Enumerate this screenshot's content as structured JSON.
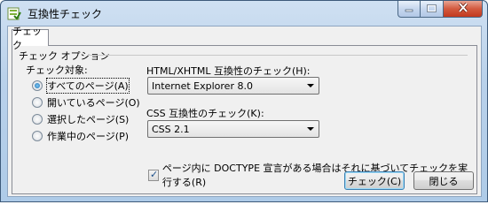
{
  "window": {
    "title": "互換性チェック"
  },
  "tab": {
    "label": "チェック"
  },
  "options": {
    "legend": "チェック オプション",
    "target_label": "チェック対象:",
    "radios": [
      {
        "label": "すべてのページ(A)",
        "checked": true
      },
      {
        "label": "開いているページ(O)",
        "checked": false
      },
      {
        "label": "選択したページ(S)",
        "checked": false
      },
      {
        "label": "作業中のページ(P)",
        "checked": false
      }
    ],
    "html_label": "HTML/XHTML 互換性のチェック(H):",
    "html_value": "Internet Explorer 8.0",
    "css_label": "CSS 互換性のチェック(K):",
    "css_value": "CSS 2.1",
    "doctype_label": "ページ内に DOCTYPE 宣言がある場合はそれに基づいてチェックを実行する(R)",
    "doctype_checked": true
  },
  "buttons": {
    "check": "チェック(C)",
    "close": "閉じる"
  },
  "icons": {
    "app": "compatibility-check-icon",
    "minimize": "minimize-icon",
    "maximize": "maximize-icon",
    "close": "close-icon",
    "combo_arrow": "chevron-down-icon",
    "checkmark": "checkmark-icon"
  }
}
